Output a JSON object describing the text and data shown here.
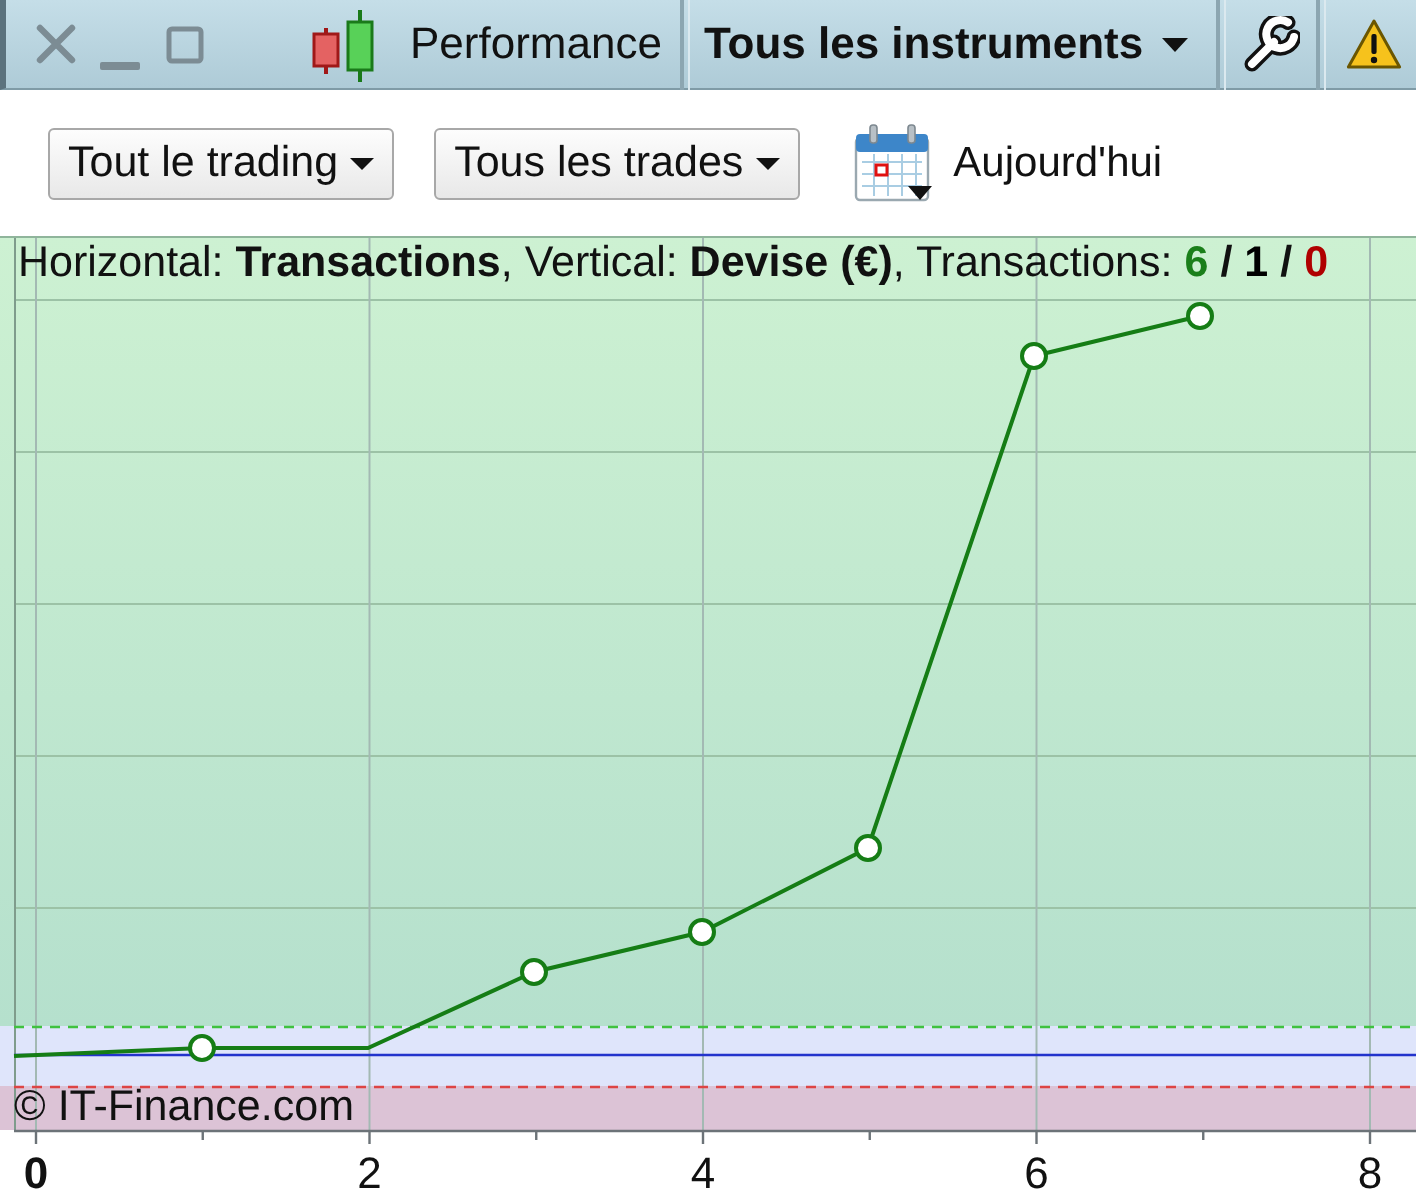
{
  "toolbar": {
    "title": "Performance",
    "instrument_filter": "Tous les instruments"
  },
  "filters": {
    "dropdowns": [
      {
        "label": "Tout le trading"
      },
      {
        "label": "Tous les trades"
      }
    ],
    "date_button": "Aujourd'hui"
  },
  "chart": {
    "summary": "Horizontal: **Transactions**, Vertical: **Devise (€)**, Transactions:",
    "counts": [
      {
        "value": "6",
        "color": "#1a7f1a"
      },
      {
        "value": "1",
        "color": "#000000"
      },
      {
        "value": "0",
        "color": "#b00000"
      }
    ],
    "count_separator": "/",
    "copyright": "© IT-Finance.com",
    "x_ticks": [
      {
        "label": "0",
        "emphasized": true
      },
      {
        "label": "2",
        "emphasized": false
      },
      {
        "label": "4",
        "emphasized": false
      },
      {
        "label": "6",
        "emphasized": false
      },
      {
        "label": "8",
        "emphasized": false
      }
    ]
  }
}
